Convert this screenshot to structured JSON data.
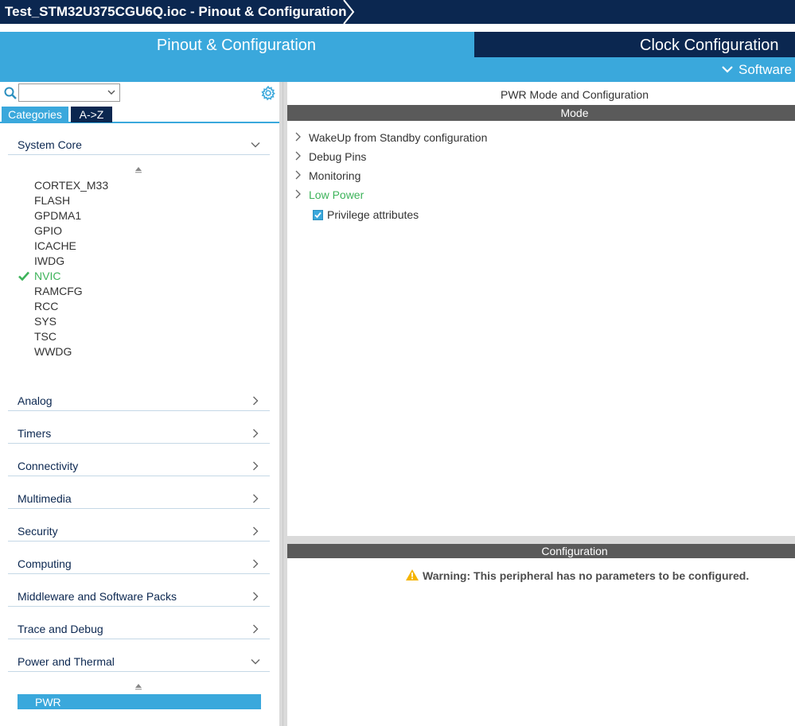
{
  "window": {
    "title": "Test_STM32U375CGU6Q.ioc - Pinout & Configuration"
  },
  "main_tabs": {
    "pinout": "Pinout & Configuration",
    "clock": "Clock Configuration"
  },
  "sub_tabs": {
    "software": "Software"
  },
  "left_panel": {
    "view_tabs": {
      "categories": "Categories",
      "az": "A->Z"
    },
    "categories": {
      "system_core": {
        "label": "System Core",
        "items": [
          "CORTEX_M33",
          "FLASH",
          "GPDMA1",
          "GPIO",
          "ICACHE",
          "IWDG",
          "NVIC",
          "RAMCFG",
          "RCC",
          "SYS",
          "TSC",
          "WWDG"
        ],
        "selected": "NVIC"
      },
      "analog": "Analog",
      "timers": "Timers",
      "connectivity": "Connectivity",
      "multimedia": "Multimedia",
      "security": "Security",
      "computing": "Computing",
      "middleware": "Middleware and Software Packs",
      "trace": "Trace and Debug",
      "power": {
        "label": "Power and Thermal",
        "items": [
          "PWR"
        ],
        "selected": "PWR"
      }
    }
  },
  "right_panel": {
    "title": "PWR Mode and Configuration",
    "mode_header": "Mode",
    "mode_tree": [
      "WakeUp from Standby configuration",
      "Debug Pins",
      "Monitoring",
      "Low Power"
    ],
    "active_node": "Low Power",
    "checkbox": {
      "label": "Privilege attributes",
      "checked": true
    },
    "config_header": "Configuration",
    "warning": "Warning: This peripheral has no parameters to be configured."
  },
  "colors": {
    "navy": "#0b2750",
    "accent": "#3aa8dc",
    "success": "#3db35a",
    "header_gray": "#5a5a5a",
    "warning": "#f5b400"
  }
}
